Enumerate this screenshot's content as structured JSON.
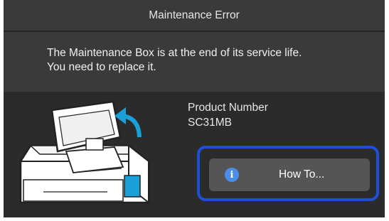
{
  "dialog": {
    "title": "Maintenance Error",
    "message_line1": "The Maintenance Box is at the end of its service life.",
    "message_line2": "You need to replace it."
  },
  "product": {
    "label": "Product Number",
    "value": "SC31MB"
  },
  "actions": {
    "how_to_label": "How To...",
    "how_to_icon": "info-icon"
  },
  "colors": {
    "focus_ring": "#1f4fd6",
    "info_icon": "#4a8ee8",
    "maintenance_box_highlight": "#1aa0d8"
  }
}
